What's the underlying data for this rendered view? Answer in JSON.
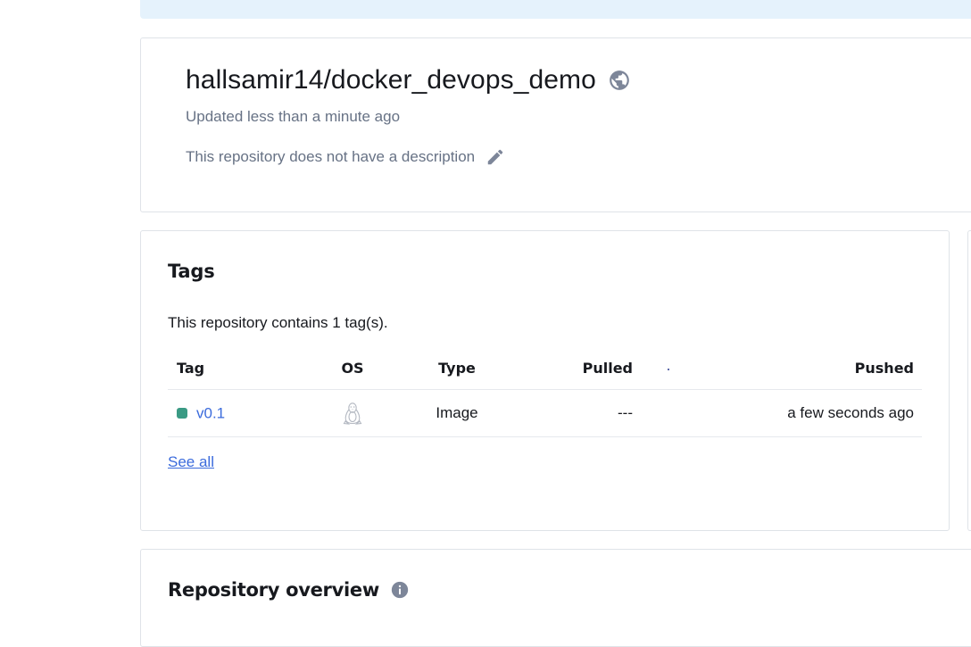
{
  "repo": {
    "name": "hallsamir14/docker_devops_demo",
    "updated": "Updated less than a minute ago",
    "description": "This repository does not have a description",
    "visibility_icon": "globe-icon",
    "edit_icon": "pencil-icon"
  },
  "tags": {
    "heading": "Tags",
    "count_text": "This repository contains 1 tag(s).",
    "columns": {
      "tag": "Tag",
      "os": "OS",
      "type": "Type",
      "pulled": "Pulled",
      "pushed": "Pushed"
    },
    "rows": [
      {
        "tag": "v0.1",
        "os_icon": "linux-icon",
        "type": "Image",
        "pulled": "---",
        "pushed": "a few seconds ago",
        "status_color": "#3a9a84"
      }
    ],
    "see_all": "See all"
  },
  "overview": {
    "heading": "Repository overview",
    "info_icon": "info-icon"
  },
  "colors": {
    "banner": "#e5f2fc",
    "link": "#3b6bdc",
    "muted_text": "#677285",
    "icon_gray": "#7d8699"
  }
}
